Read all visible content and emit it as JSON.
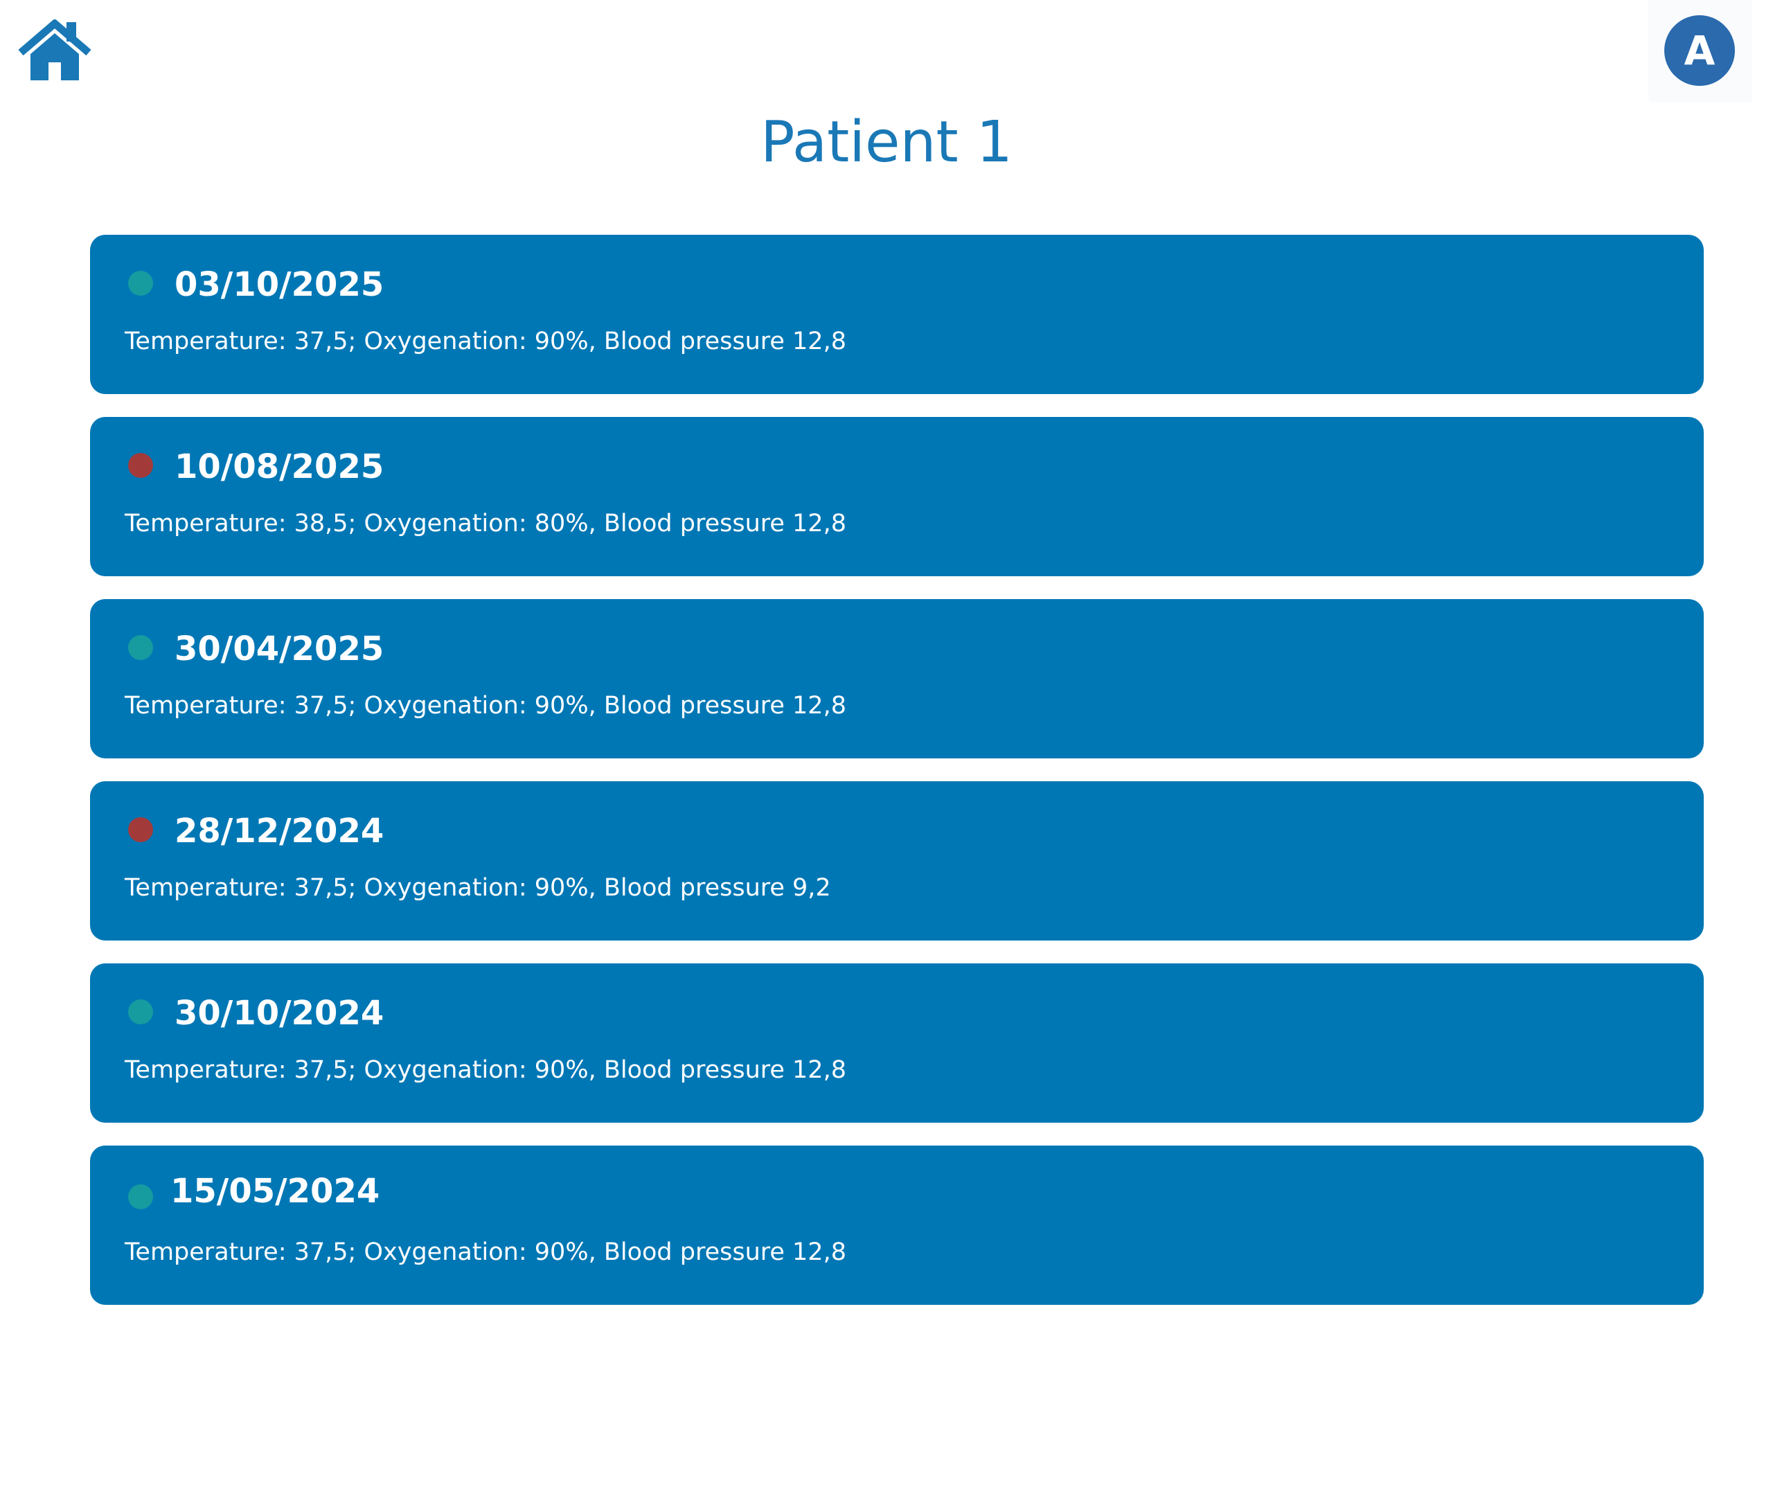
{
  "header": {
    "home_icon": "home-icon",
    "avatar_letter": "A"
  },
  "page": {
    "title": "Patient 1"
  },
  "colors": {
    "accent": "#0077b5",
    "title": "#1a78b6",
    "avatar": "#2a6aad",
    "status_ok": "#169c9f",
    "status_alert": "#a23a3a"
  },
  "records": [
    {
      "date": "03/10/2025",
      "status": "ok",
      "vitals": "Temperature: 37,5; Oxygenation: 90%, Blood pressure 12,8"
    },
    {
      "date": "10/08/2025",
      "status": "alert",
      "vitals": "Temperature: 38,5; Oxygenation: 80%, Blood pressure 12,8"
    },
    {
      "date": "30/04/2025",
      "status": "ok",
      "vitals": "Temperature: 37,5; Oxygenation: 90%, Blood pressure 12,8"
    },
    {
      "date": "28/12/2024",
      "status": "alert",
      "vitals": "Temperature: 37,5; Oxygenation: 90%, Blood pressure 9,2"
    },
    {
      "date": "30/10/2024",
      "status": "ok",
      "vitals": "Temperature: 37,5; Oxygenation: 90%, Blood pressure 12,8"
    },
    {
      "date": "15/05/2024",
      "status": "ok",
      "vitals": "Temperature: 37,5; Oxygenation: 90%, Blood pressure 12,8"
    }
  ]
}
